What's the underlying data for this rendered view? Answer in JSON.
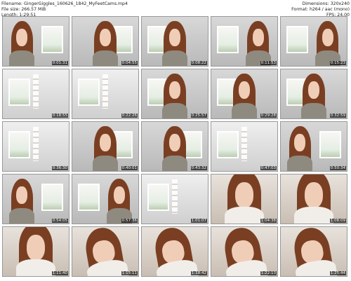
{
  "header": {
    "filename_label": "Filename: GingerGiggles_160626_1842_MyFeetCams.mp4",
    "filesize_label": "File size: 266.57 MiB",
    "length_label": "Length: 1:29:51",
    "dimensions_label": "Dimensions: 320x240",
    "format_label": "Format: h264 / aac (mono)",
    "fps_label": "FPS: 24.00"
  },
  "thumbnails": [
    {
      "timestamp": "0:01:31"
    },
    {
      "timestamp": "0:04:55"
    },
    {
      "timestamp": "0:08:22"
    },
    {
      "timestamp": "0:11:53"
    },
    {
      "timestamp": "0:15:23"
    },
    {
      "timestamp": "0:18:55"
    },
    {
      "timestamp": "0:22:26"
    },
    {
      "timestamp": "0:25:57"
    },
    {
      "timestamp": "0:29:28"
    },
    {
      "timestamp": "0:32:59"
    },
    {
      "timestamp": "0:36:30"
    },
    {
      "timestamp": "0:40:01"
    },
    {
      "timestamp": "0:43:32"
    },
    {
      "timestamp": "0:47:03"
    },
    {
      "timestamp": "0:50:34"
    },
    {
      "timestamp": "0:54:05"
    },
    {
      "timestamp": "0:57:36"
    },
    {
      "timestamp": "1:01:07"
    },
    {
      "timestamp": "1:04:38"
    },
    {
      "timestamp": "1:08:09"
    },
    {
      "timestamp": "1:11:40"
    },
    {
      "timestamp": "1:15:11"
    },
    {
      "timestamp": "1:18:42"
    },
    {
      "timestamp": "1:22:13"
    },
    {
      "timestamp": "1:25:44"
    }
  ]
}
